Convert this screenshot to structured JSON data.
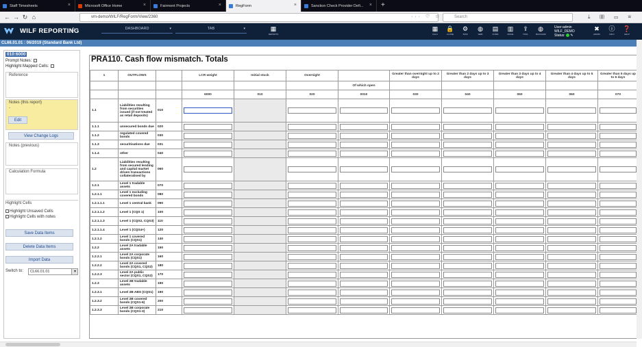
{
  "browser": {
    "tabs": [
      {
        "label": "Staff Timesheets",
        "color": "#3a7bd5",
        "active": false
      },
      {
        "label": "Microsoft Office Home",
        "color": "#d83b01",
        "active": false
      },
      {
        "label": "Fairmont Projects",
        "color": "#3a7bd5",
        "active": false
      },
      {
        "label": "RegForm",
        "color": "#3a7bd5",
        "active": true
      },
      {
        "label": "Sanction Check Provider Defi...",
        "color": "#3a7bd5",
        "active": false
      }
    ],
    "new_tab": "+",
    "url": "vm-demo/WILF/RegForm/View/2360",
    "search_placeholder": "Search"
  },
  "app": {
    "logo_text": "WILF REPORTING",
    "dashboard_label": "DASHBOARD",
    "tab_label": "TAB",
    "reports_label": "REPORTS",
    "toolbar": [
      {
        "icon": "grid-icon",
        "label": "CALC"
      },
      {
        "icon": "lock-icon",
        "label": "CLOSE"
      },
      {
        "icon": "gear-icon",
        "label": "TASK"
      },
      {
        "icon": "globe-icon",
        "label": "WEB"
      },
      {
        "icon": "table-icon",
        "label": "FORM"
      },
      {
        "icon": "book-icon",
        "label": "MODE"
      },
      {
        "icon": "arrow-icon",
        "label": "TOOL"
      },
      {
        "icon": "globe-icon",
        "label": "BACKGRD"
      }
    ],
    "user_line1": "User:admin",
    "user_line2": "WILF_DEMO",
    "status_label": "Status:",
    "status_color": "#33cc33",
    "right_icons": [
      {
        "icon": "tools-icon",
        "label": "ADMIN"
      },
      {
        "icon": "info-icon",
        "label": "INFO"
      },
      {
        "icon": "help-icon",
        "label": "HELP"
      }
    ]
  },
  "breadcrumb": "CL66.01.01 : 06/2019 (Standard Bank Ltd)",
  "sidebar": {
    "code": "010:6000",
    "prompt_notes": "Prompt Notes:",
    "highlight_mapped": "Highlight Mapped Cells:",
    "reference": "Reference",
    "notes_this": "Notes (this report)",
    "notes_dash": "-",
    "edit_button": "Edit",
    "view_change_logs": "View Change Logs",
    "notes_previous": "Notes (previous)",
    "calculation_formula": "Calculation Formula",
    "highlight_cells": "Highlight Cells",
    "highlight_unsaved": "Highlight Unsaved Cells",
    "highlight_notes": "Highlight Cells with notes",
    "save_button": "Save Data Items",
    "delete_button": "Delete Data Items",
    "import_button": "Import Data",
    "switch_to": "Switch to:",
    "switch_value": "CL66.01.01"
  },
  "report": {
    "title": "PRA110. Cash flow mismatch. Totals",
    "headers": {
      "num": "1",
      "outflows": "OUTFLOWS",
      "lcr": "LCR weight",
      "initial": "Initial stock",
      "overnight": "Overnight",
      "c1": "Greater than overnight up to 2 days",
      "c2": "Greater than 2 days up to 3 days",
      "c3": "Greater than 3 days up to 4 days",
      "c4": "Greater than 4 days up to 5 days",
      "c5": "Greater than 5 days up to 6 days",
      "which_open": "Of which open",
      "code_lcr": "6000",
      "code_init": "010",
      "code_ovn": "020",
      "code_open": "0010",
      "code_c1": "030",
      "code_c2": "040",
      "code_c3": "050",
      "code_c4": "060",
      "code_c5": "070"
    },
    "rows": [
      {
        "num": "1.1",
        "label": "Liabilities resulting from securities issued (if not treated as retail deposits)",
        "code": "010",
        "tall": true
      },
      {
        "num": "1.1.1",
        "label": "unsecured bonds due",
        "code": "020"
      },
      {
        "num": "1.1.2",
        "label": "regulated covered bonds",
        "code": "030"
      },
      {
        "num": "1.1.3",
        "label": "securitisations due",
        "code": "031"
      },
      {
        "num": "1.1.4",
        "label": "other",
        "code": "040"
      },
      {
        "num": "1.2",
        "label": "Liabilities resulting from secured lending and capital market driven transactions collateralised by",
        "code": "060",
        "tall": true
      },
      {
        "num": "1.2.1",
        "label": "Level 1 tradable assets",
        "code": "070"
      },
      {
        "num": "1.2.1.1",
        "label": "Level 1 excluding covered bonds",
        "code": "080"
      },
      {
        "num": "1.2.1.1.1",
        "label": "Level 1 central bank",
        "code": "090"
      },
      {
        "num": "1.2.1.1.2",
        "label": "Level 1 (CQS 1)",
        "code": "100"
      },
      {
        "num": "1.2.1.1.3",
        "label": "Level 1 (CQS2, CQS3)",
        "code": "110"
      },
      {
        "num": "1.2.1.1.4",
        "label": "Level 1 (CQS4+)",
        "code": "120"
      },
      {
        "num": "1.2.1.2",
        "label": "Level 1 covered bonds (CQS1)",
        "code": "140"
      },
      {
        "num": "1.2.2",
        "label": "Level 2A tradable assets",
        "code": "150"
      },
      {
        "num": "1.2.2.1",
        "label": "Level 2A corporate bonds (CQS1)",
        "code": "160"
      },
      {
        "num": "1.2.2.2",
        "label": "Level 2A covered bonds (CQS1, CQS2)",
        "code": "180"
      },
      {
        "num": "1.2.2.3",
        "label": "Level 2A public sector (CQS1, CQS2)",
        "code": "170"
      },
      {
        "num": "1.2.3",
        "label": "Level 2B tradable assets",
        "code": "190"
      },
      {
        "num": "1.2.3.1",
        "label": "Level 2B ABS (CQS1)",
        "code": "190"
      },
      {
        "num": "1.2.3.2",
        "label": "Level 2B covered bonds (CQS1-6)",
        "code": "200"
      },
      {
        "num": "1.2.3.3",
        "label": "Level 2B corporate bonds (CQS1-3)",
        "code": "210"
      }
    ]
  }
}
